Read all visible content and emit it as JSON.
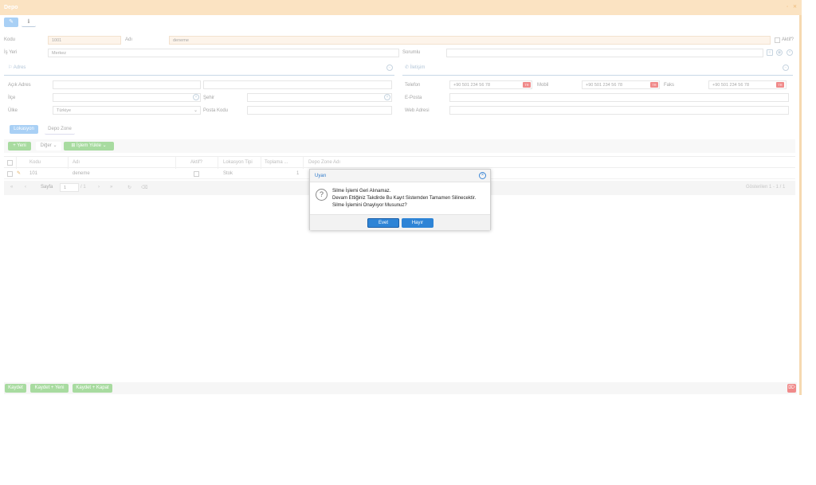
{
  "window": {
    "title": "Depo"
  },
  "form": {
    "kodu_label": "Kodu",
    "kodu_value": "1001",
    "adi_label": "Adı",
    "adi_value": "deneme",
    "aktif_label": "Aktif?",
    "isyeri_label": "İş Yeri",
    "isyeri_value": "Merkez",
    "sorumlu_label": "Sorumlu"
  },
  "address": {
    "section_title": "Adres",
    "acik_adres_label": "Açık Adres",
    "ilce_label": "İlçe",
    "sehir_label": "Şehir",
    "ulke_label": "Ülke",
    "ulke_value": "Türkiye",
    "posta_kodu_label": "Posta Kodu"
  },
  "contact": {
    "section_title": "İletişim",
    "telefon_label": "Telefon",
    "telefon_value": "+90 501 234 56 78",
    "mobil_label": "Mobil",
    "mobil_value": "+90 501 234 56 78",
    "faks_label": "Faks",
    "faks_value": "+90 501 234 56 78",
    "eposta_label": "E-Posta",
    "web_label": "Web Adresi"
  },
  "subtabs": [
    "Lokasyon",
    "Depo Zone"
  ],
  "grid_toolbar": {
    "new_label": "Yeni",
    "other_label": "Diğer",
    "excel_label": "İşlem Yükle"
  },
  "grid": {
    "columns": [
      "Kodu",
      "Adı",
      "Aktif?",
      "Lokasyon Tipi",
      "Toplama ...",
      "Depo Zone Adı"
    ],
    "rows": [
      {
        "kodu": "101",
        "adi": "deneme",
        "tip": "Stok",
        "toplama": "1"
      }
    ]
  },
  "pager": {
    "page_label": "Sayfa",
    "page_value": "1",
    "page_total": "/ 1",
    "summary": "Gösterilen 1 - 1 / 1"
  },
  "footer_buttons": [
    "Kaydet",
    "Kaydet + Yeni",
    "Kaydet + Kapat"
  ],
  "dialog": {
    "title": "Uyarı",
    "line1": "Silme İşlemi Geri Alınamaz.",
    "line2": "Devam Ettiğiniz Takdirde Bu Kayıt Sistemden Tamamen Silinecektir.",
    "line3": "Silme İşlemini Onaylıyor Musunuz?",
    "yes_label": "Evet",
    "no_label": "Hayır"
  },
  "colors": {
    "accent": "#2e84d6",
    "title_bar": "#fbe3c2",
    "danger": "#f08a8a",
    "success": "#a8dba0"
  }
}
